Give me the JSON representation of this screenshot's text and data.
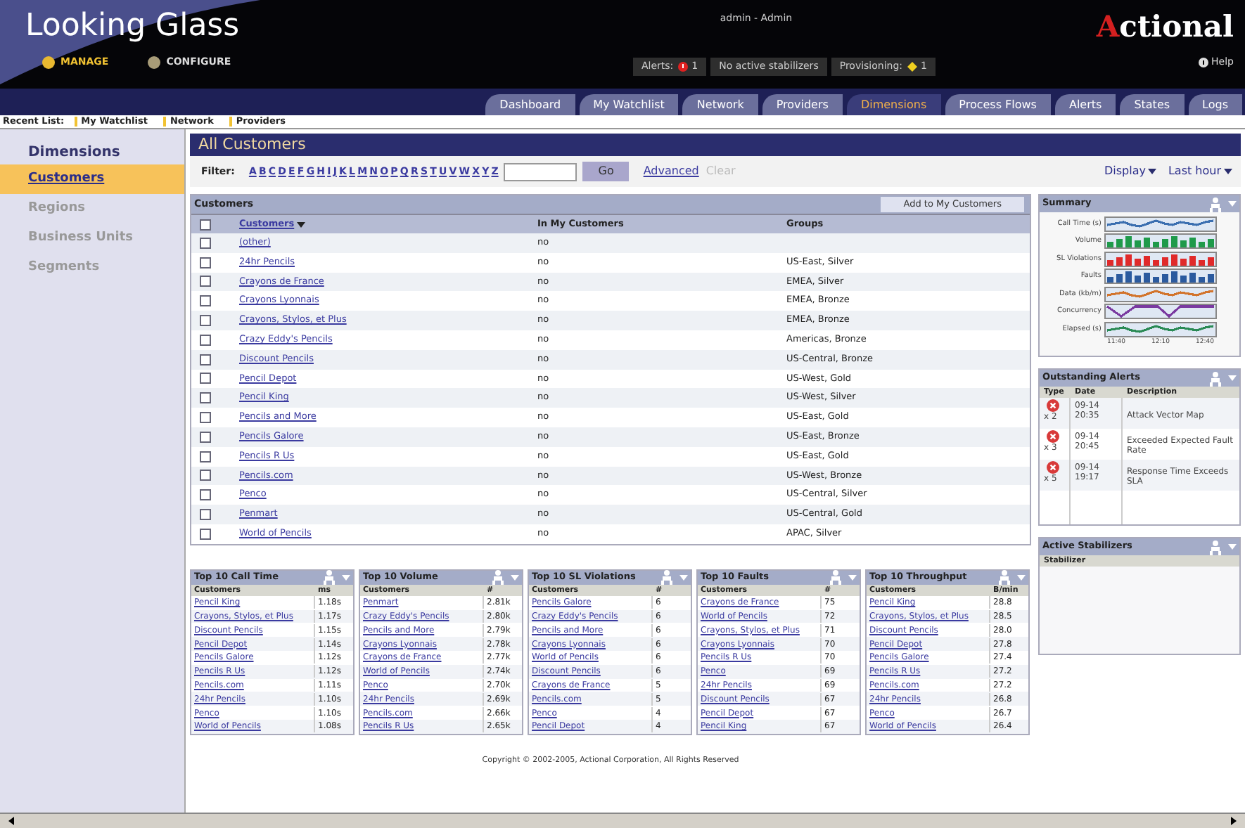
{
  "header": {
    "logo": "Looking Glass",
    "modes": [
      {
        "label": "MANAGE",
        "selected": true
      },
      {
        "label": "CONFIGURE",
        "selected": false
      }
    ],
    "user": "admin - Admin",
    "status": [
      {
        "kind": "alert",
        "label": "Alerts:",
        "count": "1"
      },
      {
        "kind": "plain",
        "label": "No active stabilizers"
      },
      {
        "kind": "warning",
        "label": "Provisioning:",
        "count": "1"
      }
    ],
    "brand_initial": "A",
    "brand_rest": "ctional",
    "help": "Help"
  },
  "tabs": [
    {
      "label": "Dashboard",
      "selected": false
    },
    {
      "label": "My Watchlist",
      "selected": false
    },
    {
      "label": "Network",
      "selected": false
    },
    {
      "label": "Providers",
      "selected": false
    },
    {
      "label": "Dimensions",
      "selected": true
    },
    {
      "label": "Process Flows",
      "selected": false
    },
    {
      "label": "Alerts",
      "selected": false
    },
    {
      "label": "States",
      "selected": false
    },
    {
      "label": "Logs",
      "selected": false
    }
  ],
  "subnav": {
    "label": "Recent List:",
    "items": [
      "My Watchlist",
      "Network",
      "Providers"
    ]
  },
  "sidebar": {
    "title": "Dimensions",
    "items": [
      {
        "label": "Customers",
        "selected": true
      },
      {
        "label": "Regions",
        "selected": false
      },
      {
        "label": "Business Units",
        "selected": false
      },
      {
        "label": "Segments",
        "selected": false
      }
    ]
  },
  "main": {
    "title": "All Customers",
    "filter_label": "Filter:",
    "letters": [
      "A",
      "B",
      "C",
      "D",
      "E",
      "F",
      "G",
      "H",
      "I",
      "J",
      "K",
      "L",
      "M",
      "N",
      "O",
      "P",
      "Q",
      "R",
      "S",
      "T",
      "U",
      "V",
      "W",
      "X",
      "Y",
      "Z"
    ],
    "go": "Go",
    "advanced": "Advanced",
    "clear": {
      "label": "Clear",
      "disabled": true
    },
    "display": "Display",
    "range": "Last hour"
  },
  "customers": {
    "title": "Customers",
    "add_button": "Add to My Customers",
    "select_all_checked": false,
    "columns": [
      "Customers",
      "In My Customers",
      "Groups"
    ],
    "rows": [
      {
        "name": "(other)",
        "in_my": "no",
        "groups": "",
        "checked": false
      },
      {
        "name": "24hr Pencils",
        "in_my": "no",
        "groups": "US-East, Silver",
        "checked": false
      },
      {
        "name": "Crayons de France",
        "in_my": "no",
        "groups": "EMEA, Silver",
        "checked": false
      },
      {
        "name": "Crayons Lyonnais",
        "in_my": "no",
        "groups": "EMEA, Bronze",
        "checked": false
      },
      {
        "name": "Crayons, Stylos, et Plus",
        "in_my": "no",
        "groups": "EMEA, Bronze",
        "checked": false
      },
      {
        "name": "Crazy Eddy's Pencils",
        "in_my": "no",
        "groups": "Americas, Bronze",
        "checked": false
      },
      {
        "name": "Discount Pencils",
        "in_my": "no",
        "groups": "US-Central, Bronze",
        "checked": false
      },
      {
        "name": "Pencil Depot",
        "in_my": "no",
        "groups": "US-West, Gold",
        "checked": false
      },
      {
        "name": "Pencil King",
        "in_my": "no",
        "groups": "US-West, Silver",
        "checked": false
      },
      {
        "name": "Pencils and More",
        "in_my": "no",
        "groups": "US-East, Gold",
        "checked": false
      },
      {
        "name": "Pencils Galore",
        "in_my": "no",
        "groups": "US-East, Bronze",
        "checked": false
      },
      {
        "name": "Pencils R Us",
        "in_my": "no",
        "groups": "US-East, Gold",
        "checked": false
      },
      {
        "name": "Pencils.com",
        "in_my": "no",
        "groups": "US-West, Bronze",
        "checked": false
      },
      {
        "name": "Penco",
        "in_my": "no",
        "groups": "US-Central, Silver",
        "checked": false
      },
      {
        "name": "Penmart",
        "in_my": "no",
        "groups": "US-Central, Gold",
        "checked": false
      },
      {
        "name": "World of Pencils",
        "in_my": "no",
        "groups": "APAC, Silver",
        "checked": false
      }
    ]
  },
  "summary": {
    "title": "Summary",
    "metrics": [
      {
        "label": "Call Time (s)",
        "kind": "line",
        "color": "#3b6fb0"
      },
      {
        "label": "Volume",
        "kind": "bar",
        "color": "#1f9a4a"
      },
      {
        "label": "SL Violations",
        "kind": "bar",
        "color": "#e02a2a"
      },
      {
        "label": "Faults",
        "kind": "bar",
        "color": "#2b5a9e"
      },
      {
        "label": "Data (kb/m)",
        "kind": "line",
        "color": "#d2742c"
      },
      {
        "label": "Concurrency",
        "kind": "zigzag",
        "color": "#7a3aa0"
      },
      {
        "label": "Elapsed (s)",
        "kind": "line",
        "color": "#2a8a55"
      }
    ],
    "x_ticks": [
      "11:40",
      "12:10",
      "12:40"
    ]
  },
  "alerts": {
    "title": "Outstanding Alerts",
    "columns": [
      "Type",
      "Date",
      "Description"
    ],
    "rows": [
      {
        "count": "x 2",
        "date": "09-14",
        "time": "20:35",
        "description": "Attack Vector Map"
      },
      {
        "count": "x 3",
        "date": "09-14",
        "time": "20:45",
        "description": "Exceeded Expected Fault Rate"
      },
      {
        "count": "x 5",
        "date": "09-14",
        "time": "19:17",
        "description": "Response Time Exceeds SLA"
      }
    ]
  },
  "stabilizers": {
    "title": "Active Stabilizers",
    "column": "Stabilizer"
  },
  "top10": [
    {
      "title": "Top 10 Call Time",
      "columns": [
        "Customers",
        "ms"
      ],
      "rows": [
        [
          "Pencil King",
          "1.18s"
        ],
        [
          "Crayons, Stylos, et Plus",
          "1.17s"
        ],
        [
          "Discount Pencils",
          "1.15s"
        ],
        [
          "Pencil Depot",
          "1.14s"
        ],
        [
          "Pencils Galore",
          "1.12s"
        ],
        [
          "Pencils R Us",
          "1.12s"
        ],
        [
          "Pencils.com",
          "1.11s"
        ],
        [
          "24hr Pencils",
          "1.10s"
        ],
        [
          "Penco",
          "1.10s"
        ],
        [
          "World of Pencils",
          "1.08s"
        ]
      ]
    },
    {
      "title": "Top 10 Volume",
      "columns": [
        "Customers",
        "#"
      ],
      "rows": [
        [
          "Penmart",
          "2.81k"
        ],
        [
          "Crazy Eddy's Pencils",
          "2.80k"
        ],
        [
          "Pencils and More",
          "2.79k"
        ],
        [
          "Crayons Lyonnais",
          "2.78k"
        ],
        [
          "Crayons de France",
          "2.77k"
        ],
        [
          "World of Pencils",
          "2.74k"
        ],
        [
          "Penco",
          "2.70k"
        ],
        [
          "24hr Pencils",
          "2.69k"
        ],
        [
          "Pencils.com",
          "2.66k"
        ],
        [
          "Pencils R Us",
          "2.65k"
        ]
      ]
    },
    {
      "title": "Top 10 SL Violations",
      "columns": [
        "Customers",
        "#"
      ],
      "rows": [
        [
          "Pencils Galore",
          "6"
        ],
        [
          "Crazy Eddy's Pencils",
          "6"
        ],
        [
          "Pencils and More",
          "6"
        ],
        [
          "Crayons Lyonnais",
          "6"
        ],
        [
          "World of Pencils",
          "6"
        ],
        [
          "Discount Pencils",
          "6"
        ],
        [
          "Crayons de France",
          "5"
        ],
        [
          "Pencils.com",
          "5"
        ],
        [
          "Penco",
          "4"
        ],
        [
          "Pencil Depot",
          "4"
        ]
      ]
    },
    {
      "title": "Top 10 Faults",
      "columns": [
        "Customers",
        "#"
      ],
      "rows": [
        [
          "Crayons de France",
          "75"
        ],
        [
          "World of Pencils",
          "72"
        ],
        [
          "Crayons, Stylos, et Plus",
          "71"
        ],
        [
          "Crayons Lyonnais",
          "70"
        ],
        [
          "Pencils R Us",
          "70"
        ],
        [
          "Penco",
          "69"
        ],
        [
          "24hr Pencils",
          "69"
        ],
        [
          "Discount Pencils",
          "67"
        ],
        [
          "Pencil Depot",
          "67"
        ],
        [
          "Pencil King",
          "67"
        ]
      ]
    },
    {
      "title": "Top 10 Throughput",
      "columns": [
        "Customers",
        "B/min"
      ],
      "rows": [
        [
          "Pencil King",
          "28.8"
        ],
        [
          "Crayons, Stylos, et Plus",
          "28.5"
        ],
        [
          "Discount Pencils",
          "28.0"
        ],
        [
          "Pencil Depot",
          "27.8"
        ],
        [
          "Pencils Galore",
          "27.4"
        ],
        [
          "Pencils R Us",
          "27.2"
        ],
        [
          "Pencils.com",
          "27.2"
        ],
        [
          "24hr Pencils",
          "26.8"
        ],
        [
          "Penco",
          "26.7"
        ],
        [
          "World of Pencils",
          "26.4"
        ]
      ]
    }
  ],
  "footer": "Copyright © 2002-2005, Actional Corporation, All Rights Reserved"
}
